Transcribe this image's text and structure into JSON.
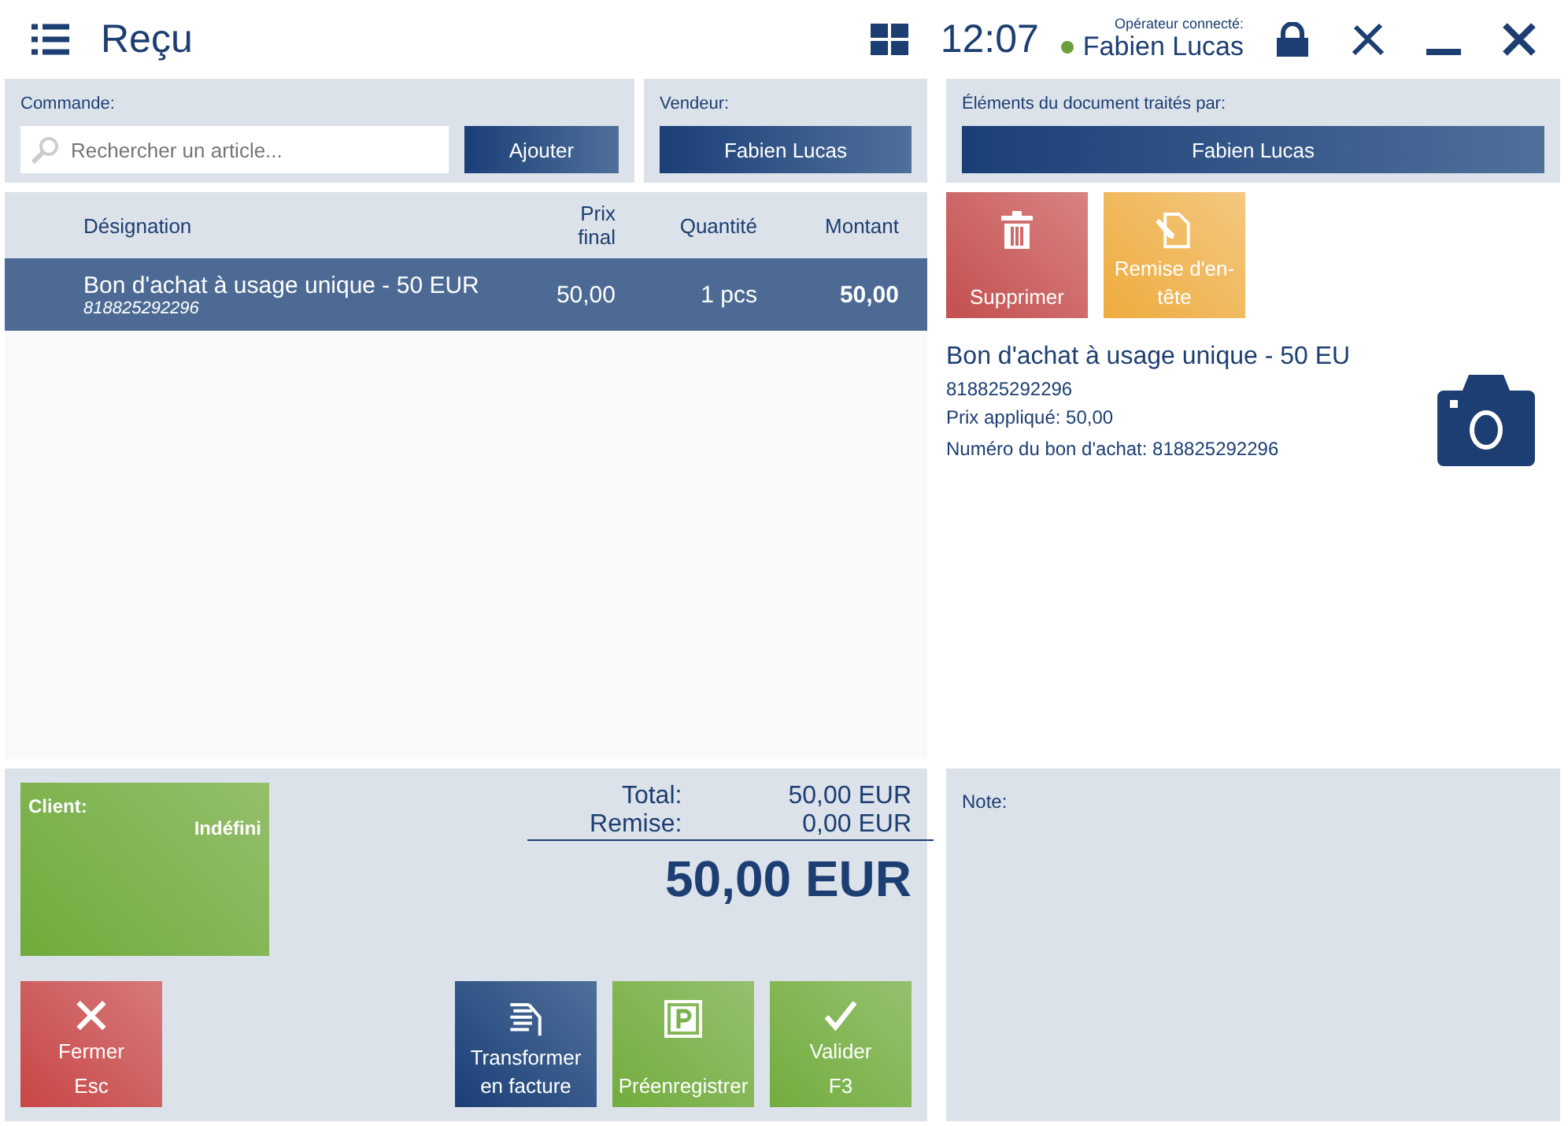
{
  "header": {
    "title": "Reçu",
    "time": "12:07",
    "operator_label": "Opérateur connecté:",
    "operator": "Fabien Lucas",
    "online": true
  },
  "order": {
    "label": "Commande:",
    "search_placeholder": "Rechercher un article...",
    "add_button": "Ajouter"
  },
  "seller": {
    "label": "Vendeur:",
    "value": "Fabien Lucas"
  },
  "processed_by": {
    "label": "Éléments du document traités par:",
    "value": "Fabien Lucas"
  },
  "table": {
    "columns": [
      "Désignation",
      "Prix final",
      "Quantité",
      "Montant"
    ],
    "rows": [
      {
        "name": "Bon d'achat à usage unique - 50 EUR",
        "code": "818825292296",
        "price": "50,00",
        "quantity": "1 pcs",
        "amount": "50,00",
        "selected": true
      }
    ]
  },
  "item_actions": [
    {
      "kind": "delete",
      "label": "Supprimer"
    },
    {
      "kind": "discount",
      "label": "Remise d'en-tête"
    }
  ],
  "details": {
    "title": "Bon d'achat à usage unique - 50 EU",
    "code": "818825292296",
    "price": "Prix appliqué: 50,00",
    "voucher": "Numéro du bon d'achat: 818825292296"
  },
  "client": {
    "label": "Client:",
    "value": "Indéfini"
  },
  "totals": {
    "total_label": "Total:",
    "total": "50,00 EUR",
    "discount_label": "Remise:",
    "discount": "0,00 EUR",
    "grand_total": "50,00 EUR"
  },
  "note": {
    "label": "Note:"
  },
  "actions": [
    {
      "kind": "close",
      "label": "Fermer",
      "key": "Esc"
    },
    {
      "kind": "invoice",
      "label": "Transformer en facture"
    },
    {
      "kind": "park",
      "label": "Préenregistrer"
    },
    {
      "kind": "confirm",
      "label": "Valider",
      "key": "F3"
    }
  ]
}
